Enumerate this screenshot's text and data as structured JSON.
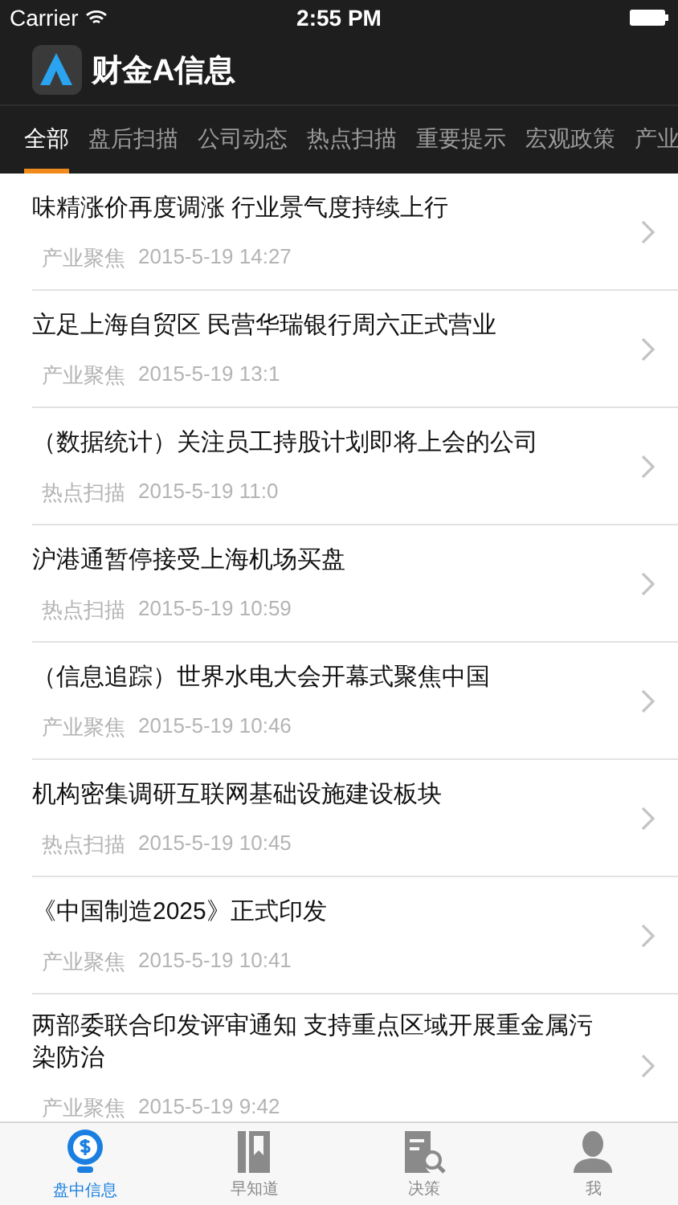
{
  "status_bar": {
    "carrier": "Carrier",
    "time": "2:55 PM"
  },
  "header": {
    "title": "财金A信息"
  },
  "tabs": [
    {
      "label": "全部",
      "selected": true
    },
    {
      "label": "盘后扫描",
      "selected": false
    },
    {
      "label": "公司动态",
      "selected": false
    },
    {
      "label": "热点扫描",
      "selected": false
    },
    {
      "label": "重要提示",
      "selected": false
    },
    {
      "label": "宏观政策",
      "selected": false
    },
    {
      "label": "产业",
      "selected": false
    }
  ],
  "articles": [
    {
      "title": "味精涨价再度调涨 行业景气度持续上行",
      "category": "产业聚焦",
      "time": "2015-5-19 14:27"
    },
    {
      "title": "立足上海自贸区 民营华瑞银行周六正式营业",
      "category": "产业聚焦",
      "time": "2015-5-19 13:1"
    },
    {
      "title": "（数据统计）关注员工持股计划即将上会的公司",
      "category": "热点扫描",
      "time": "2015-5-19 11:0"
    },
    {
      "title": "沪港通暂停接受上海机场买盘",
      "category": "热点扫描",
      "time": "2015-5-19 10:59"
    },
    {
      "title": "（信息追踪）世界水电大会开幕式聚焦中国",
      "category": "产业聚焦",
      "time": "2015-5-19 10:46"
    },
    {
      "title": "机构密集调研互联网基础设施建设板块",
      "category": "热点扫描",
      "time": "2015-5-19 10:45"
    },
    {
      "title": "《中国制造2025》正式印发",
      "category": "产业聚焦",
      "time": "2015-5-19 10:41"
    },
    {
      "title": "两部委联合印发评审通知 支持重点区域开展重金属污染防治",
      "category": "产业聚焦",
      "time": "2015-5-19 9:42"
    }
  ],
  "tab_bar": [
    {
      "label": "盘中信息",
      "kind": "bulb",
      "selected": true
    },
    {
      "label": "早知道",
      "kind": "book",
      "selected": false
    },
    {
      "label": "决策",
      "kind": "doc",
      "selected": false
    },
    {
      "label": "我",
      "kind": "person",
      "selected": false
    }
  ]
}
